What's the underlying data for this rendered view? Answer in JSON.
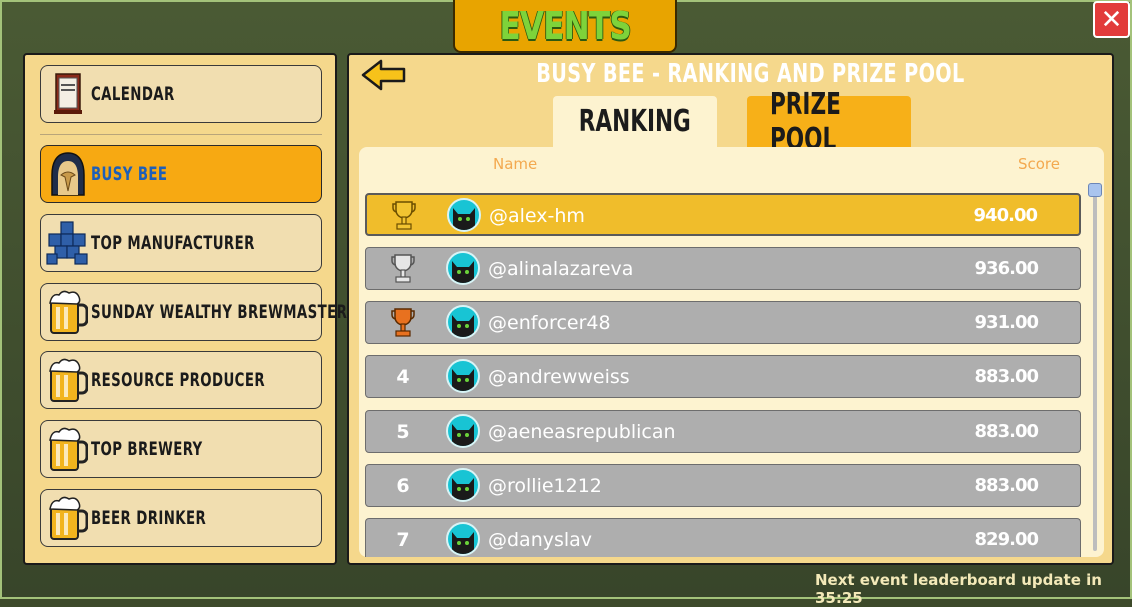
{
  "window": {
    "title": "EVENTS",
    "close_label": "✕"
  },
  "sidebar": {
    "items": [
      {
        "label": "CALENDAR",
        "icon": "calendar-icon",
        "active": false
      },
      {
        "label": "BUSY BEE",
        "icon": "bee-helmet-icon",
        "active": true
      },
      {
        "label": "TOP MANUFACTURER",
        "icon": "blocks-icon",
        "active": false
      },
      {
        "label": "SUNDAY WEALTHY BREWMASTER",
        "icon": "beer-mug-icon",
        "active": false
      },
      {
        "label": "RESOURCE PRODUCER",
        "icon": "beer-mug-icon",
        "active": false
      },
      {
        "label": "TOP BREWERY",
        "icon": "beer-mug-icon",
        "active": false
      },
      {
        "label": "BEER DRINKER",
        "icon": "beer-mug-icon",
        "active": false
      }
    ]
  },
  "main": {
    "title": "BUSY BEE - RANKING AND PRIZE POOL",
    "tabs": [
      {
        "label": "RANKING",
        "active": true
      },
      {
        "label": "PRIZE POOL",
        "active": false
      }
    ],
    "columns": {
      "name": "Name",
      "score": "Score"
    },
    "rows": [
      {
        "rank": "",
        "trophy": "gold",
        "user": "@alex-hm",
        "score": "940.00"
      },
      {
        "rank": "",
        "trophy": "silver",
        "user": "@alinalazareva",
        "score": "936.00"
      },
      {
        "rank": "",
        "trophy": "bronze",
        "user": "@enforcer48",
        "score": "931.00"
      },
      {
        "rank": "4",
        "trophy": "",
        "user": "@andrewweiss",
        "score": "883.00"
      },
      {
        "rank": "5",
        "trophy": "",
        "user": "@aeneasrepublican",
        "score": "883.00"
      },
      {
        "rank": "6",
        "trophy": "",
        "user": "@rollie1212",
        "score": "883.00"
      },
      {
        "rank": "7",
        "trophy": "",
        "user": "@danyslav",
        "score": "829.00"
      }
    ]
  },
  "footer": {
    "text": "Next event leaderboard update in 35:25"
  },
  "colors": {
    "accent": "#f7a912",
    "gold": "#e0b12a",
    "silver": "#d0d0d0",
    "bronze": "#e0671a"
  }
}
